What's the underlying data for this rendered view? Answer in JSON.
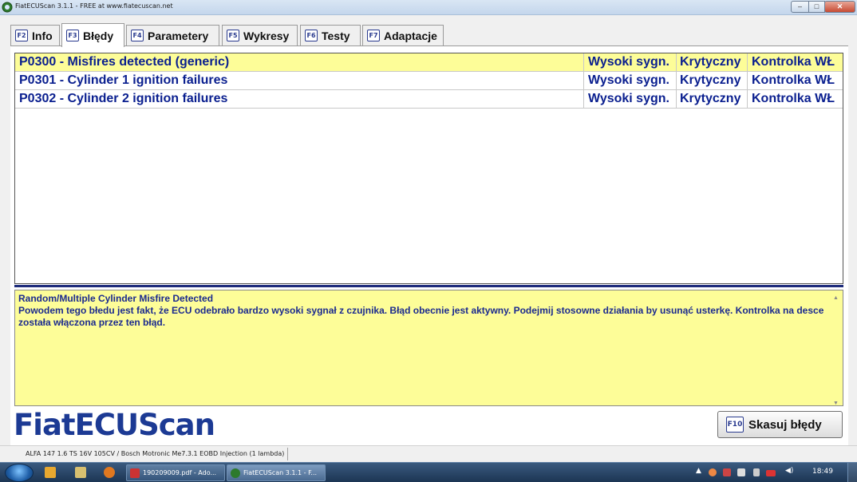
{
  "window": {
    "title": "FiatECUScan 3.1.1 - FREE at www.fiatecuscan.net",
    "min_glyph": "‒",
    "max_glyph": "□",
    "close_glyph": "✕"
  },
  "tabs": [
    {
      "key": "F2",
      "label": "Info"
    },
    {
      "key": "F3",
      "label": "Błędy",
      "active": true
    },
    {
      "key": "F4",
      "label": "Parametery"
    },
    {
      "key": "F5",
      "label": "Wykresy"
    },
    {
      "key": "F6",
      "label": "Testy"
    },
    {
      "key": "F7",
      "label": "Adaptacje"
    }
  ],
  "errors": [
    {
      "code": "P0300 - Misfires detected (generic)",
      "signal": "Wysoki sygn.",
      "severity": "Krytyczny",
      "lamp": "Kontrolka WŁ",
      "selected": true
    },
    {
      "code": "P0301 - Cylinder 1 ignition failures",
      "signal": "Wysoki sygn.",
      "severity": "Krytyczny",
      "lamp": "Kontrolka WŁ"
    },
    {
      "code": "P0302 - Cylinder 2 ignition failures",
      "signal": "Wysoki sygn.",
      "severity": "Krytyczny",
      "lamp": "Kontrolka WŁ"
    }
  ],
  "description": {
    "title": "Random/Multiple Cylinder Misfire Detected",
    "body": "Powodem tego błedu jest fakt, że ECU odebrało bardzo wysoki sygnał z czujnika. Błąd obecnie jest aktywny. Podejmij stosowne działania by usunąć usterkę. Kontrolka na desce została włączona przez ten błąd."
  },
  "logo": "FiatECUScan",
  "clear_button": {
    "key": "F10",
    "label": "Skasuj błędy"
  },
  "status": "ALFA 147 1.6 TS 16V 105CV / Bosch Motronic Me7.3.1 EOBD Injection (1 lambda)",
  "taskbar": {
    "tasks": [
      "190209009.pdf - Ado...",
      "FiatECUScan 3.1.1 - F..."
    ],
    "tray_arrow": "▲",
    "volume": "◀)",
    "clock": "18:49"
  },
  "colors": {
    "selected_row": "#fdfd98",
    "text_blue": "#0a1f8f",
    "logo_blue": "#1c3a94"
  }
}
